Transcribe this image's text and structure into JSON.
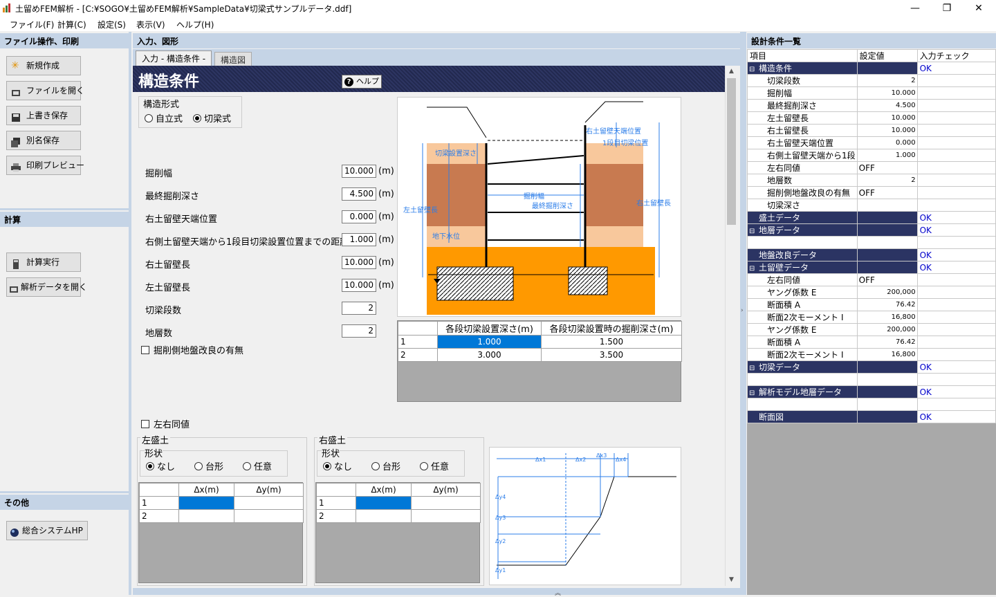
{
  "window": {
    "title": "土留めFEM解析 - [C:¥SOGO¥土留めFEM解析¥SampleData¥切梁式サンプルデータ.ddf]",
    "minimize": "—",
    "restore": "❐",
    "close": "✕"
  },
  "menu": [
    "ファイル(F)",
    "計算(C)",
    "設定(S)",
    "表示(V)",
    "ヘルプ(H)"
  ],
  "left": {
    "file_header": "ファイル操作、印刷",
    "file_buttons": [
      "新規作成",
      "ファイルを開く",
      "上書き保存",
      "別名保存",
      "印刷プレビュー"
    ],
    "calc_header": "計算",
    "calc_buttons": [
      "計算実行",
      "解析データを開く"
    ],
    "other_header": "その他",
    "other_buttons": [
      "総合システムHP"
    ]
  },
  "center": {
    "header": "入力、図形",
    "tabs": [
      "入力 - 構造条件 -",
      "構造図"
    ],
    "page_title": "構造条件",
    "help_button": "ヘルプ",
    "structure_type_label": "構造形式",
    "structure_options": [
      "自立式",
      "切梁式"
    ],
    "structure_selected": "切梁式",
    "unit": "(m)",
    "fields": [
      {
        "label": "掘削幅",
        "value": "10.000",
        "unit": true
      },
      {
        "label": "最終掘削深さ",
        "value": "4.500",
        "unit": true
      },
      {
        "label": "右土留壁天端位置",
        "value": "0.000",
        "unit": true
      },
      {
        "label": "右側土留壁天端から1段目切梁設置位置までの距離",
        "value": "1.000",
        "unit": true
      },
      {
        "label": "右土留壁長",
        "value": "10.000",
        "unit": true
      },
      {
        "label": "左土留壁長",
        "value": "10.000",
        "unit": true
      },
      {
        "label": "切梁段数",
        "value": "2",
        "unit": false
      },
      {
        "label": "地層数",
        "value": "2",
        "unit": false
      }
    ],
    "ground_improvement_label": "掘削側地盤改良の有無",
    "strut_table": {
      "headers": [
        "",
        "各段切梁設置深さ(m)",
        "各段切梁設置時の掘削深さ(m)"
      ],
      "rows": [
        [
          "1",
          "1.000",
          "1.500"
        ],
        [
          "2",
          "3.000",
          "3.500"
        ]
      ]
    },
    "diagram_labels": {
      "right_top": "右土留壁天端位置",
      "first_strut": "1段目切梁位置",
      "strut_depth": "切梁設置深さ",
      "excavation_width": "掘削幅",
      "final_depth": "最終掘削深さ",
      "left_wall": "左土留壁長",
      "right_wall": "右土留壁長",
      "water_level": "地下水位"
    },
    "same_lr_label": "左右同値",
    "left_fill": {
      "title": "左盛土",
      "shape_label": "形状",
      "options": [
        "なし",
        "台形",
        "任意"
      ],
      "selected": "なし",
      "headers": [
        "",
        "Δx(m)",
        "Δy(m)"
      ],
      "rows": [
        [
          "1",
          "",
          ""
        ],
        [
          "2",
          "",
          ""
        ]
      ]
    },
    "right_fill": {
      "title": "右盛土",
      "shape_label": "形状",
      "options": [
        "なし",
        "台形",
        "任意"
      ],
      "selected": "なし",
      "headers": [
        "",
        "Δx(m)",
        "Δy(m)"
      ],
      "rows": [
        [
          "1",
          "",
          ""
        ],
        [
          "2",
          "",
          ""
        ]
      ]
    },
    "fill_diagram_labels": {
      "dx": [
        "Δx1",
        "Δx2",
        "Δx3",
        "Δx4"
      ],
      "dy": [
        "Δy4",
        "Δy3",
        "Δy2",
        "Δy1"
      ]
    }
  },
  "right": {
    "header": "設計条件一覧",
    "columns": [
      "項目",
      "設定値",
      "入力チェック"
    ],
    "rows": [
      {
        "type": "cat",
        "expand": "⊟",
        "label": "構造条件",
        "value": "",
        "check": "OK"
      },
      {
        "type": "item",
        "label": "切梁段数",
        "value": "2",
        "check": ""
      },
      {
        "type": "item",
        "label": "掘削幅",
        "value": "10.000",
        "check": ""
      },
      {
        "type": "item",
        "label": "最終掘削深さ",
        "value": "4.500",
        "check": ""
      },
      {
        "type": "item",
        "label": "左土留壁長",
        "value": "10.000",
        "check": ""
      },
      {
        "type": "item",
        "label": "右土留壁長",
        "value": "10.000",
        "check": ""
      },
      {
        "type": "item",
        "label": "右土留壁天端位置",
        "value": "0.000",
        "check": ""
      },
      {
        "type": "item",
        "label": "右側土留壁天端から1段",
        "value": "1.000",
        "check": ""
      },
      {
        "type": "item",
        "label": "左右同値",
        "value": "OFF",
        "check": ""
      },
      {
        "type": "item",
        "label": "地層数",
        "value": "2",
        "check": ""
      },
      {
        "type": "item",
        "label": "掘削側地盤改良の有無",
        "value": "OFF",
        "check": ""
      },
      {
        "type": "item",
        "label": "切梁深さ",
        "value": "",
        "check": ""
      },
      {
        "type": "cat",
        "expand": "",
        "label": "盛土データ",
        "value": "",
        "check": "OK"
      },
      {
        "type": "cat",
        "expand": "⊟",
        "label": "地層データ",
        "value": "",
        "check": "OK"
      },
      {
        "type": "empty",
        "label": "",
        "value": "",
        "check": ""
      },
      {
        "type": "cat",
        "expand": "",
        "label": "地盤改良データ",
        "value": "",
        "check": "OK"
      },
      {
        "type": "cat",
        "expand": "⊟",
        "label": "土留壁データ",
        "value": "",
        "check": "OK"
      },
      {
        "type": "item",
        "label": "左右同値",
        "value": "OFF",
        "check": ""
      },
      {
        "type": "item",
        "label": "ヤング係数 E",
        "value": "200,000",
        "check": ""
      },
      {
        "type": "item",
        "label": "断面積 A",
        "value": "76.42",
        "check": ""
      },
      {
        "type": "item",
        "label": "断面2次モーメント I",
        "value": "16,800",
        "check": ""
      },
      {
        "type": "item",
        "label": "ヤング係数 E",
        "value": "200,000",
        "check": ""
      },
      {
        "type": "item",
        "label": "断面積 A",
        "value": "76.42",
        "check": ""
      },
      {
        "type": "item",
        "label": "断面2次モーメント I",
        "value": "16,800",
        "check": ""
      },
      {
        "type": "cat",
        "expand": "⊟",
        "label": "切梁データ",
        "value": "",
        "check": "OK"
      },
      {
        "type": "empty",
        "label": "",
        "value": "",
        "check": ""
      },
      {
        "type": "cat",
        "expand": "⊟",
        "label": "解析モデル地層データ",
        "value": "",
        "check": "OK"
      },
      {
        "type": "empty",
        "label": "",
        "value": "",
        "check": ""
      },
      {
        "type": "cat",
        "expand": "",
        "label": "断面図",
        "value": "",
        "check": "OK"
      }
    ]
  }
}
